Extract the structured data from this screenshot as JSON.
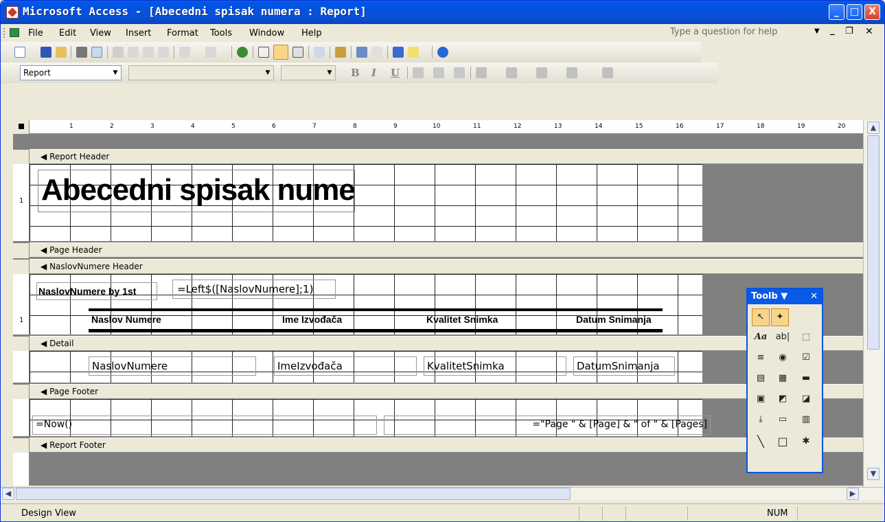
{
  "window": {
    "title": "Microsoft Access - [Abecedni spisak numera : Report]",
    "controls": [
      "_",
      "□",
      "X"
    ]
  },
  "menu": {
    "items": [
      "File",
      "Edit",
      "View",
      "Insert",
      "Format",
      "Tools",
      "Window",
      "Help"
    ],
    "help_placeholder": "Type a question for help"
  },
  "format_toolbar": {
    "object_combo": "Report",
    "font_combo": "",
    "size_combo": "",
    "bold": "B",
    "italic": "I",
    "underline": "U"
  },
  "ruler": {
    "labels": [
      "1",
      "2",
      "3",
      "4",
      "5",
      "6",
      "7",
      "8",
      "9",
      "10",
      "11",
      "12",
      "13",
      "14",
      "15",
      "16",
      "17",
      "18",
      "19",
      "20"
    ]
  },
  "sections": {
    "report_header": "Report Header",
    "page_header": "Page Header",
    "group_header": "NaslovNumere Header",
    "detail": "Detail",
    "page_footer": "Page Footer",
    "report_footer": "Report Footer"
  },
  "controls": {
    "report_title": "Abecedni spisak numera",
    "group_label": "NaslovNumere by 1st",
    "group_expr": "=Left$([NaslovNumere];1)",
    "col_headers": [
      "Naslov Numere",
      "Ime Izvođača",
      "Kvalitet Snimka",
      "Datum Snimanja"
    ],
    "detail_fields": [
      "NaslovNumere",
      "ImeIzvođača",
      "KvalitetSnimka",
      "DatumSnimanja"
    ],
    "now_expr": "=Now()",
    "page_expr": "=\"Page \" & [Page] & \" of \" & [Pages]"
  },
  "toolbox": {
    "title": "Toolb",
    "tools": [
      "pointer-tool",
      "wizard-tool",
      "label-tool",
      "textbox-tool",
      "optiongroup-tool",
      "toggle-tool",
      "option-tool",
      "checkbox-tool",
      "combobox-tool",
      "listbox-tool",
      "commandbutton-tool",
      "image-tool",
      "unbound-object-tool",
      "bound-object-tool",
      "pagebreak-tool",
      "tabcontrol-tool",
      "subform-tool",
      "line-tool",
      "rectangle-tool",
      "more-tools"
    ],
    "label_glyph": "Aa",
    "textbox_glyph": "ab|"
  },
  "status": {
    "mode": "Design View",
    "num": "NUM"
  }
}
